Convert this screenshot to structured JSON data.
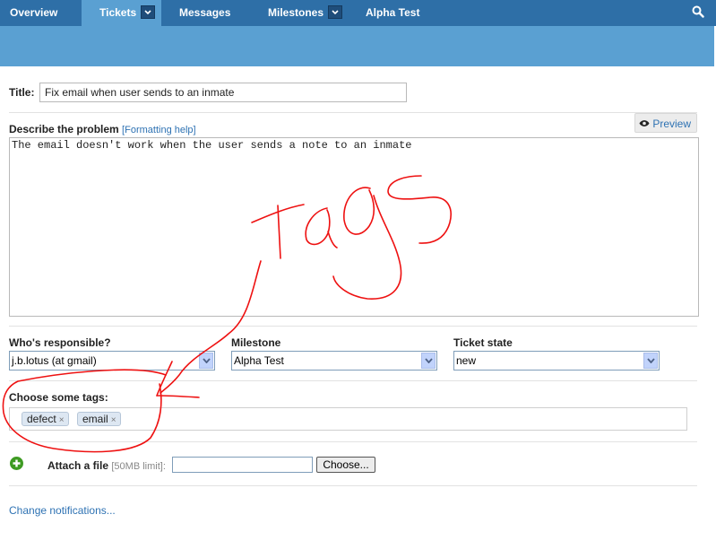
{
  "nav": {
    "items": [
      {
        "label": "Overview",
        "active": false,
        "dropdown": false
      },
      {
        "label": "Tickets",
        "active": true,
        "dropdown": true
      },
      {
        "label": "Messages",
        "active": false,
        "dropdown": false
      },
      {
        "label": "Milestones",
        "active": false,
        "dropdown": true
      },
      {
        "label": "Alpha Test",
        "active": false,
        "dropdown": false
      }
    ],
    "search_icon": "search-icon"
  },
  "form": {
    "title_label": "Title:",
    "title_value": "Fix email when user sends to an inmate",
    "describe_label": "Describe the problem",
    "formatting_open": "[",
    "formatting_help": "Formatting help",
    "formatting_close": "]",
    "preview_label": "Preview",
    "description": "The email doesn't work when the user sends a note to an inmate",
    "responsible_label": "Who's responsible?",
    "responsible_value": "j.b.lotus (at gmail)",
    "milestone_label": "Milestone",
    "milestone_value": "Alpha Test",
    "state_label": "Ticket state",
    "state_value": "new",
    "tags_label": "Choose some tags:",
    "tags": [
      {
        "label": "defect",
        "remove": "×"
      },
      {
        "label": "email",
        "remove": "×"
      }
    ],
    "attach_label": "Attach a file",
    "attach_limit": "[50MB limit]:",
    "choose_label": "Choose...",
    "change_notifications": "Change notifications..."
  },
  "annotation": {
    "text": "Tags",
    "color": "#ee1111"
  },
  "colors": {
    "nav_bg": "#2e6fa7",
    "subbar_bg": "#5aa0d2",
    "link": "#2e72b3",
    "add_green": "#3e9b23"
  }
}
